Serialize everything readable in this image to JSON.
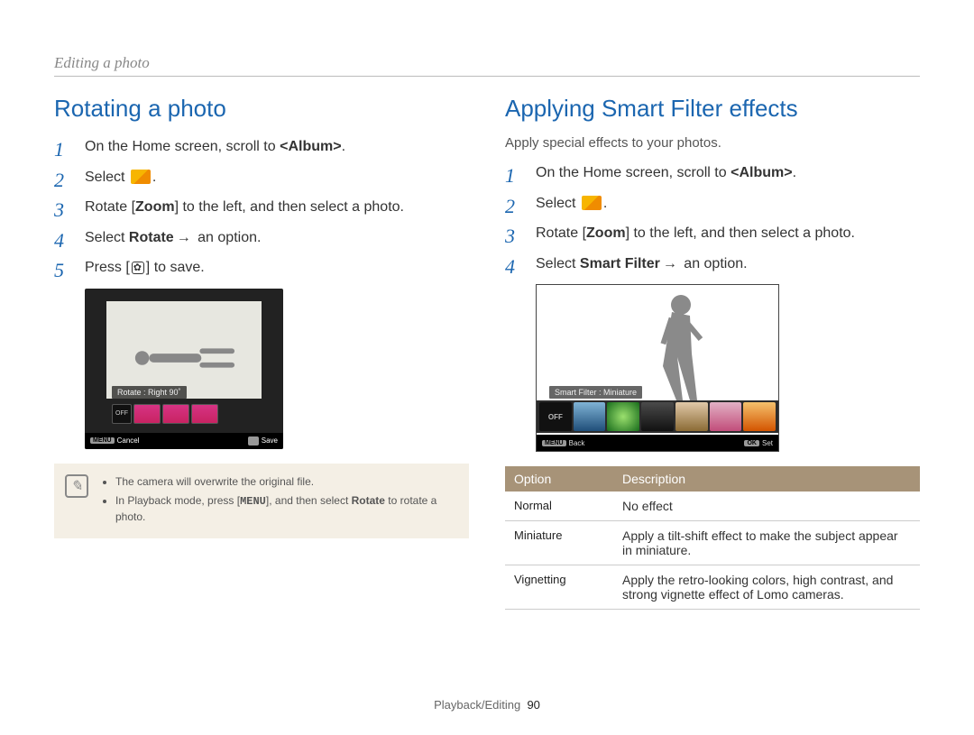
{
  "breadcrumb": "Editing a photo",
  "left": {
    "heading": "Rotating a photo",
    "steps": {
      "s1_a": "On the Home screen, scroll to ",
      "s1_b": "<Album>",
      "s1_c": ".",
      "s2_a": "Select ",
      "s2_b": ".",
      "s3_a": "Rotate [",
      "s3_b": "Zoom",
      "s3_c": "] to the left, and then select a photo.",
      "s4_a": "Select ",
      "s4_b": "Rotate",
      "s4_arrow": "→",
      "s4_c": " an option.",
      "s5_a": "Press [",
      "s5_b": "] to save."
    },
    "cam": {
      "label": "Rotate : Right 90˚",
      "off": "OFF",
      "menu": "MENU",
      "cancel": "Cancel",
      "save": "Save"
    },
    "note1": "The camera will overwrite the original file.",
    "note2_a": "In Playback mode, press [",
    "note2_menu": "MENU",
    "note2_b": "], and then select ",
    "note2_rot": "Rotate",
    "note2_c": " to rotate a photo."
  },
  "right": {
    "heading": "Applying Smart Filter effects",
    "subtitle": "Apply special effects to your photos.",
    "steps": {
      "s1_a": "On the Home screen, scroll to ",
      "s1_b": "<Album>",
      "s1_c": ".",
      "s2_a": "Select ",
      "s2_b": ".",
      "s3_a": "Rotate [",
      "s3_b": "Zoom",
      "s3_c": "] to the left, and then select a photo.",
      "s4_a": "Select ",
      "s4_b": "Smart Filter",
      "s4_arrow": "→",
      "s4_c": " an option."
    },
    "cam": {
      "label": "Smart Filter : Miniature",
      "off": "OFF",
      "menu": "MENU",
      "back": "Back",
      "ok": "OK",
      "set": "Set"
    },
    "table": {
      "h1": "Option",
      "h2": "Description",
      "rows": [
        {
          "opt": "Normal",
          "desc": "No effect"
        },
        {
          "opt": "Miniature",
          "desc": "Apply a tilt-shift effect to make the subject appear in miniature."
        },
        {
          "opt": "Vignetting",
          "desc": "Apply the retro-looking colors, high contrast, and strong vignette effect of Lomo cameras."
        }
      ]
    }
  },
  "footer": {
    "section": "Playback/Editing",
    "page": "90"
  }
}
